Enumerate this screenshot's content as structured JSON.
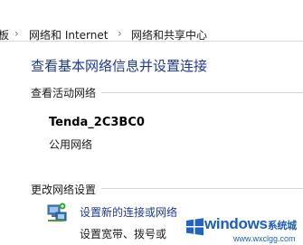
{
  "breadcrumb": {
    "items": [
      {
        "label": "板"
      },
      {
        "label": "网络和 Internet"
      },
      {
        "label": "网络和共享中心"
      }
    ]
  },
  "main": {
    "title": "查看基本网络信息并设置连接",
    "active_networks_label": "查看活动网络",
    "network": {
      "name": "Tenda_2C3BC0",
      "type": "公用网络"
    },
    "change_settings_label": "更改网络设置",
    "task": {
      "link": "设置新的连接或网络",
      "desc": "设置宽带、拨号或"
    }
  },
  "watermark": {
    "brand": "windows",
    "brand_cn": "系统城",
    "url": "www.wxclgg.com"
  },
  "colors": {
    "link_blue": "#1e3a96",
    "divider": "#d6d6d6"
  }
}
